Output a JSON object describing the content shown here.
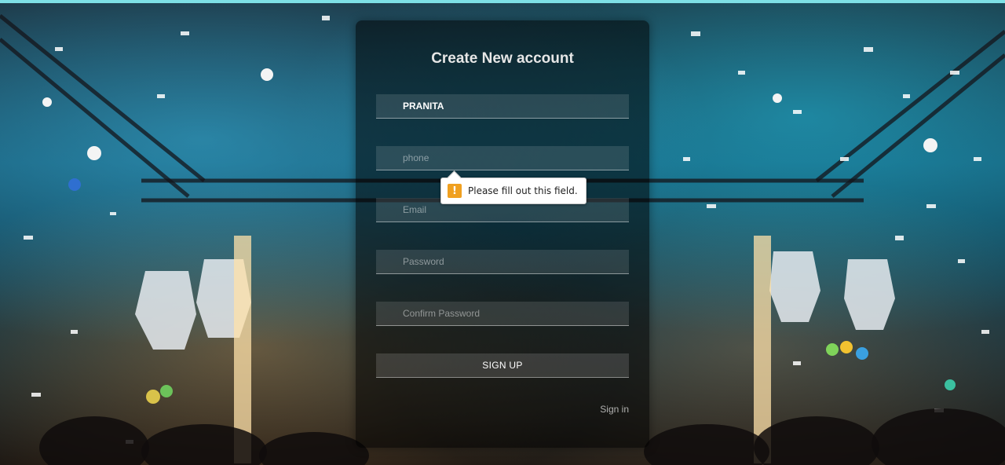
{
  "form": {
    "title": "Create New account",
    "name_value": "PRANITA",
    "phone_placeholder": "phone",
    "email_placeholder": "Email",
    "password_placeholder": "Password",
    "confirm_password_placeholder": "Confirm Password",
    "signup_label": "SIGN UP",
    "signin_label": "Sign in"
  },
  "validation_tooltip": {
    "icon": "warning-icon",
    "icon_glyph": "!",
    "message": "Please fill out this field."
  },
  "colors": {
    "accent_top_line": "#7ee0e6",
    "warning": "#f0a020"
  }
}
